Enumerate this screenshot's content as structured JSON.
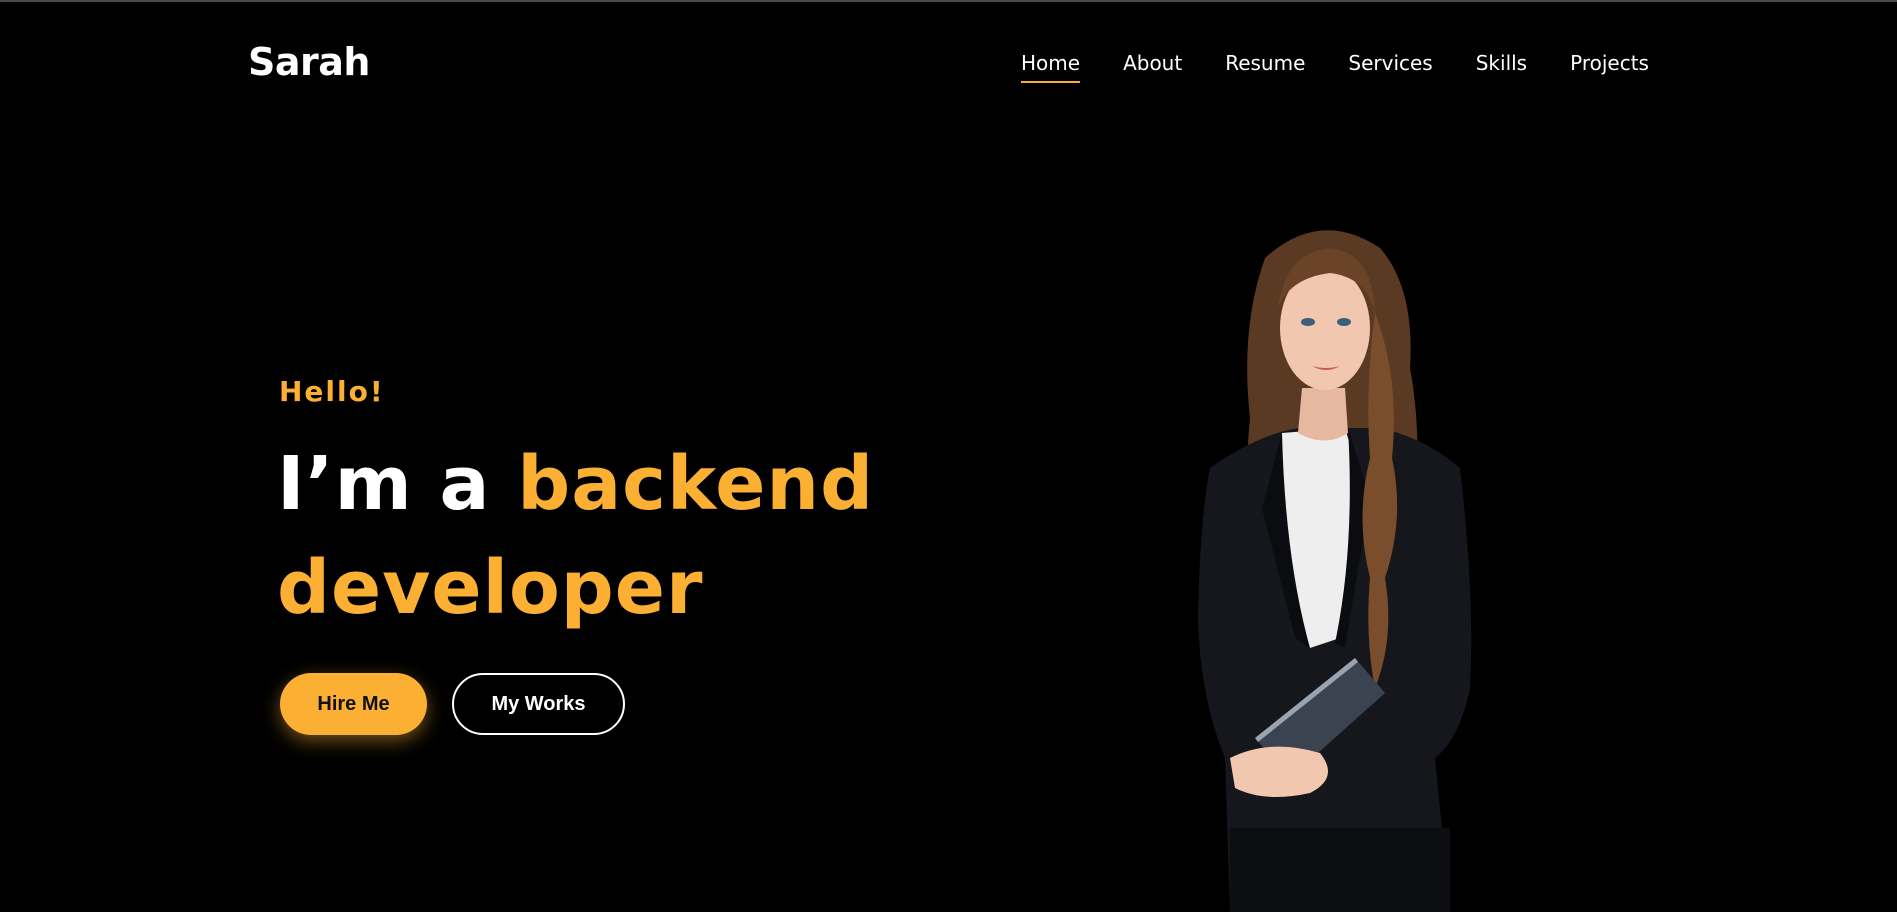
{
  "brand": {
    "name": "Sarah"
  },
  "nav": {
    "items": [
      {
        "label": "Home",
        "active": true
      },
      {
        "label": "About"
      },
      {
        "label": "Resume"
      },
      {
        "label": "Services"
      },
      {
        "label": "Skills"
      },
      {
        "label": "Projects"
      }
    ]
  },
  "hero": {
    "greeting": "Hello!",
    "headline_prefix": "I’m a ",
    "headline_accent_1": "backend",
    "headline_accent_2": "developer",
    "buttons": {
      "hire": "Hire Me",
      "works": "My Works"
    },
    "portrait_icon": "woman-portrait-image"
  },
  "colors": {
    "background": "#000000",
    "accent": "#fbb034",
    "text": "#ffffff"
  }
}
